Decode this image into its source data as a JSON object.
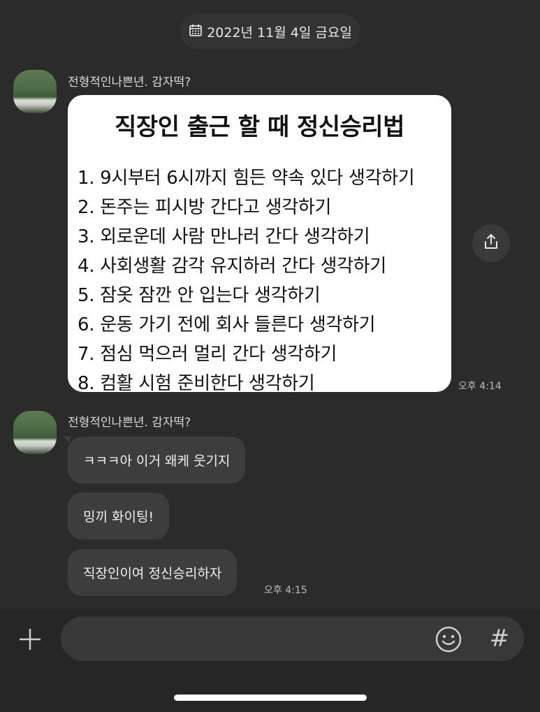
{
  "date_header": {
    "label": "2022년 11월 4일 금요일",
    "icon": "calendar-icon"
  },
  "messages": [
    {
      "sender": "전형적인나쁜년. 감자떡?",
      "image": {
        "title": "직장인 출근 할 때 정신승리법",
        "items": [
          "1.  9시부터 6시까지 힘든 약속 있다 생각하기",
          "2.  돈주는 피시방 간다고 생각하기",
          "3.  외로운데 사람 만나러 간다 생각하기",
          "4.  사회생활 감각 유지하러 간다 생각하기",
          "5.  잠옷 잠깐 안 입는다 생각하기",
          "6.  운동 가기 전에 회사 들른다 생각하기",
          "7.  점심 먹으러 멀리 간다 생각하기",
          "8.  컴활 시험 준비한다 생각하기"
        ]
      },
      "time": "오후 4:14"
    },
    {
      "sender": "전형적인나쁜년. 감자떡?",
      "bubbles": [
        "ㅋㅋㅋ아 이거 왜케 웃기지",
        "밍끼 화이팅!",
        "직장인이여 정신승리하자"
      ],
      "time": "오후 4:15"
    }
  ],
  "composer": {
    "input_value": "",
    "icons": [
      "plus-icon",
      "emoji-icon",
      "hash-icon"
    ],
    "hash_label": "#"
  },
  "colors": {
    "background": "#2b2b2b",
    "bubble": "#3d3d3d",
    "composer": "#262626",
    "input": "#383838"
  }
}
